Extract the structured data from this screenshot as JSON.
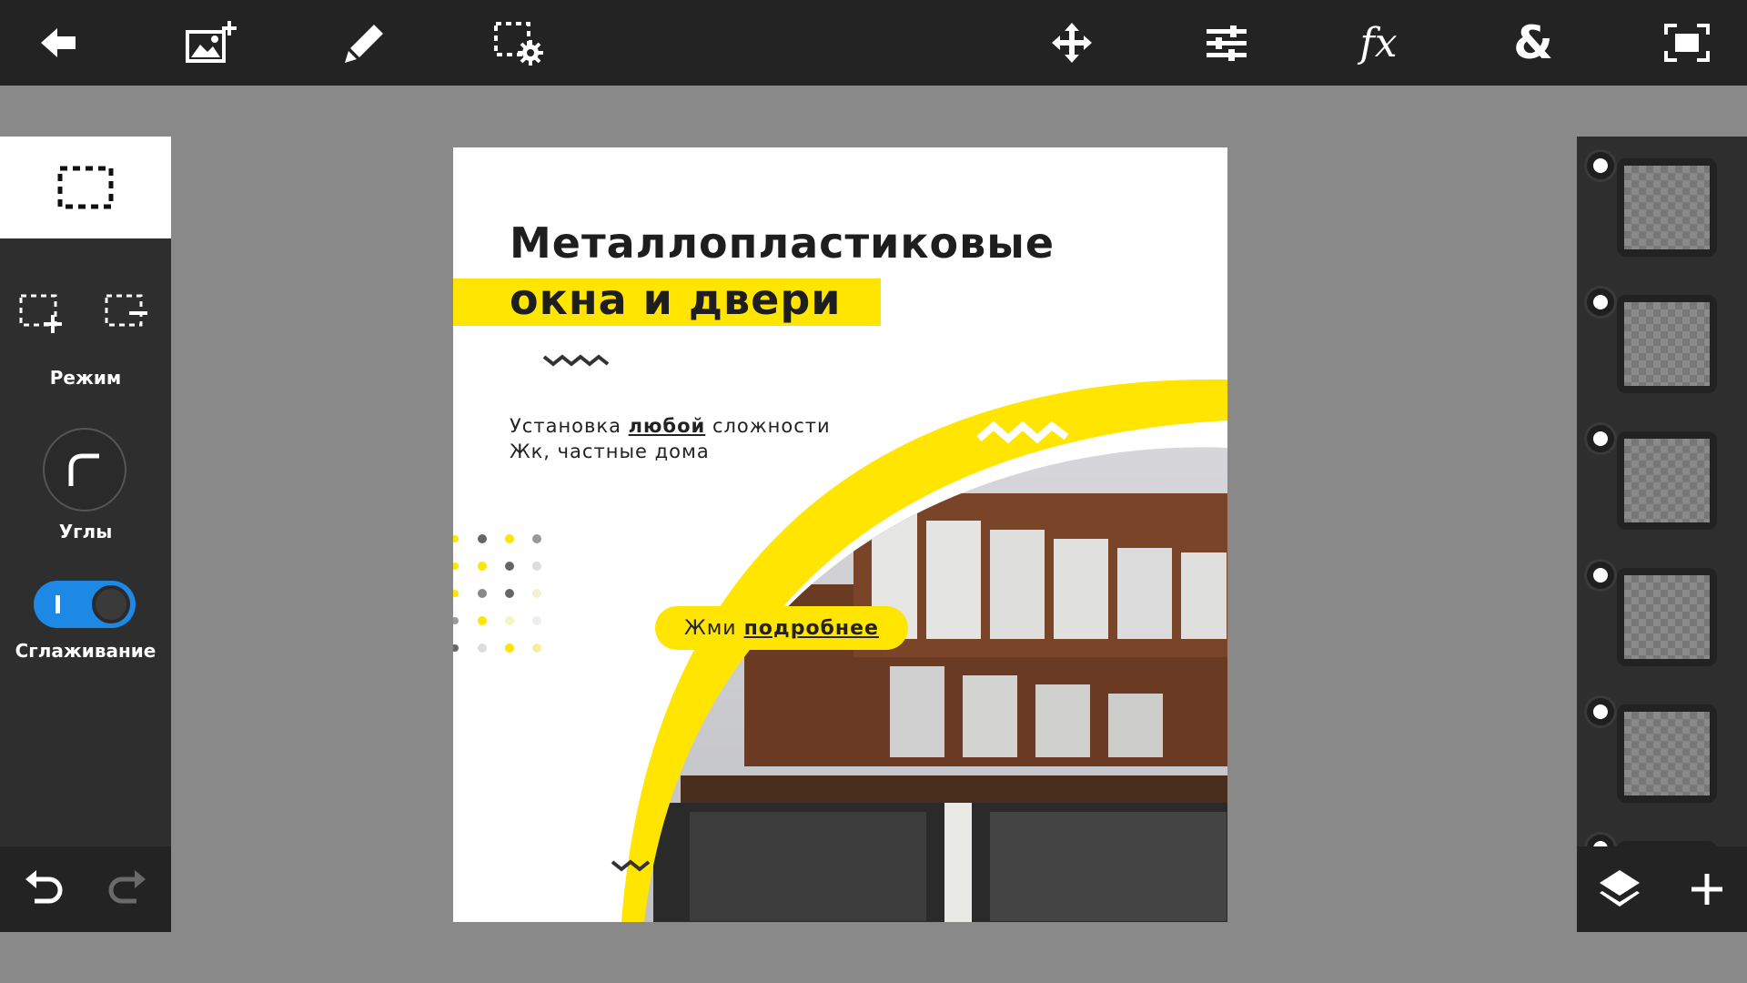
{
  "toolbar": {
    "items": [
      "back-icon",
      "add-image-icon",
      "brush-icon",
      "selection-settings-icon",
      "move-icon",
      "adjustments-icon",
      "fx-icon",
      "blend-icon",
      "fit-screen-icon"
    ],
    "fx_label": "fx",
    "blend_label": "&"
  },
  "left_panel": {
    "mode_label": "Режим",
    "corners_label": "Углы",
    "smoothing_label": "Сглаживание",
    "smoothing_on": true,
    "accent": "#1e88e5"
  },
  "canvas": {
    "title_line1": "Металлопластиковые",
    "title_line2": "окна и двери",
    "sub1_prefix": "Установка",
    "sub1_emph": "любой",
    "sub1_suffix": "сложности",
    "sub2": "Жк, частные дома",
    "cta_prefix": "Жми",
    "cta_emph": "подробнее",
    "accent": "#ffe500"
  },
  "layers": {
    "count_visible": 6
  }
}
